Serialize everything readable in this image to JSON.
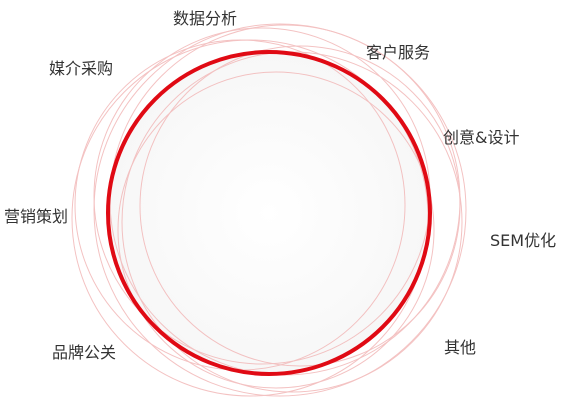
{
  "diagram": {
    "accent_color": "#e00a14",
    "faint_ring_color": "#f2b8b8",
    "labels": {
      "data_analysis": "数据分析",
      "customer_service": "客户服务",
      "media_buying": "媒介采购",
      "creative_design": "创意&设计",
      "marketing_planning": "营销策划",
      "sem_optimization": "SEM优化",
      "brand_pr": "品牌公关",
      "other": "其他"
    }
  }
}
